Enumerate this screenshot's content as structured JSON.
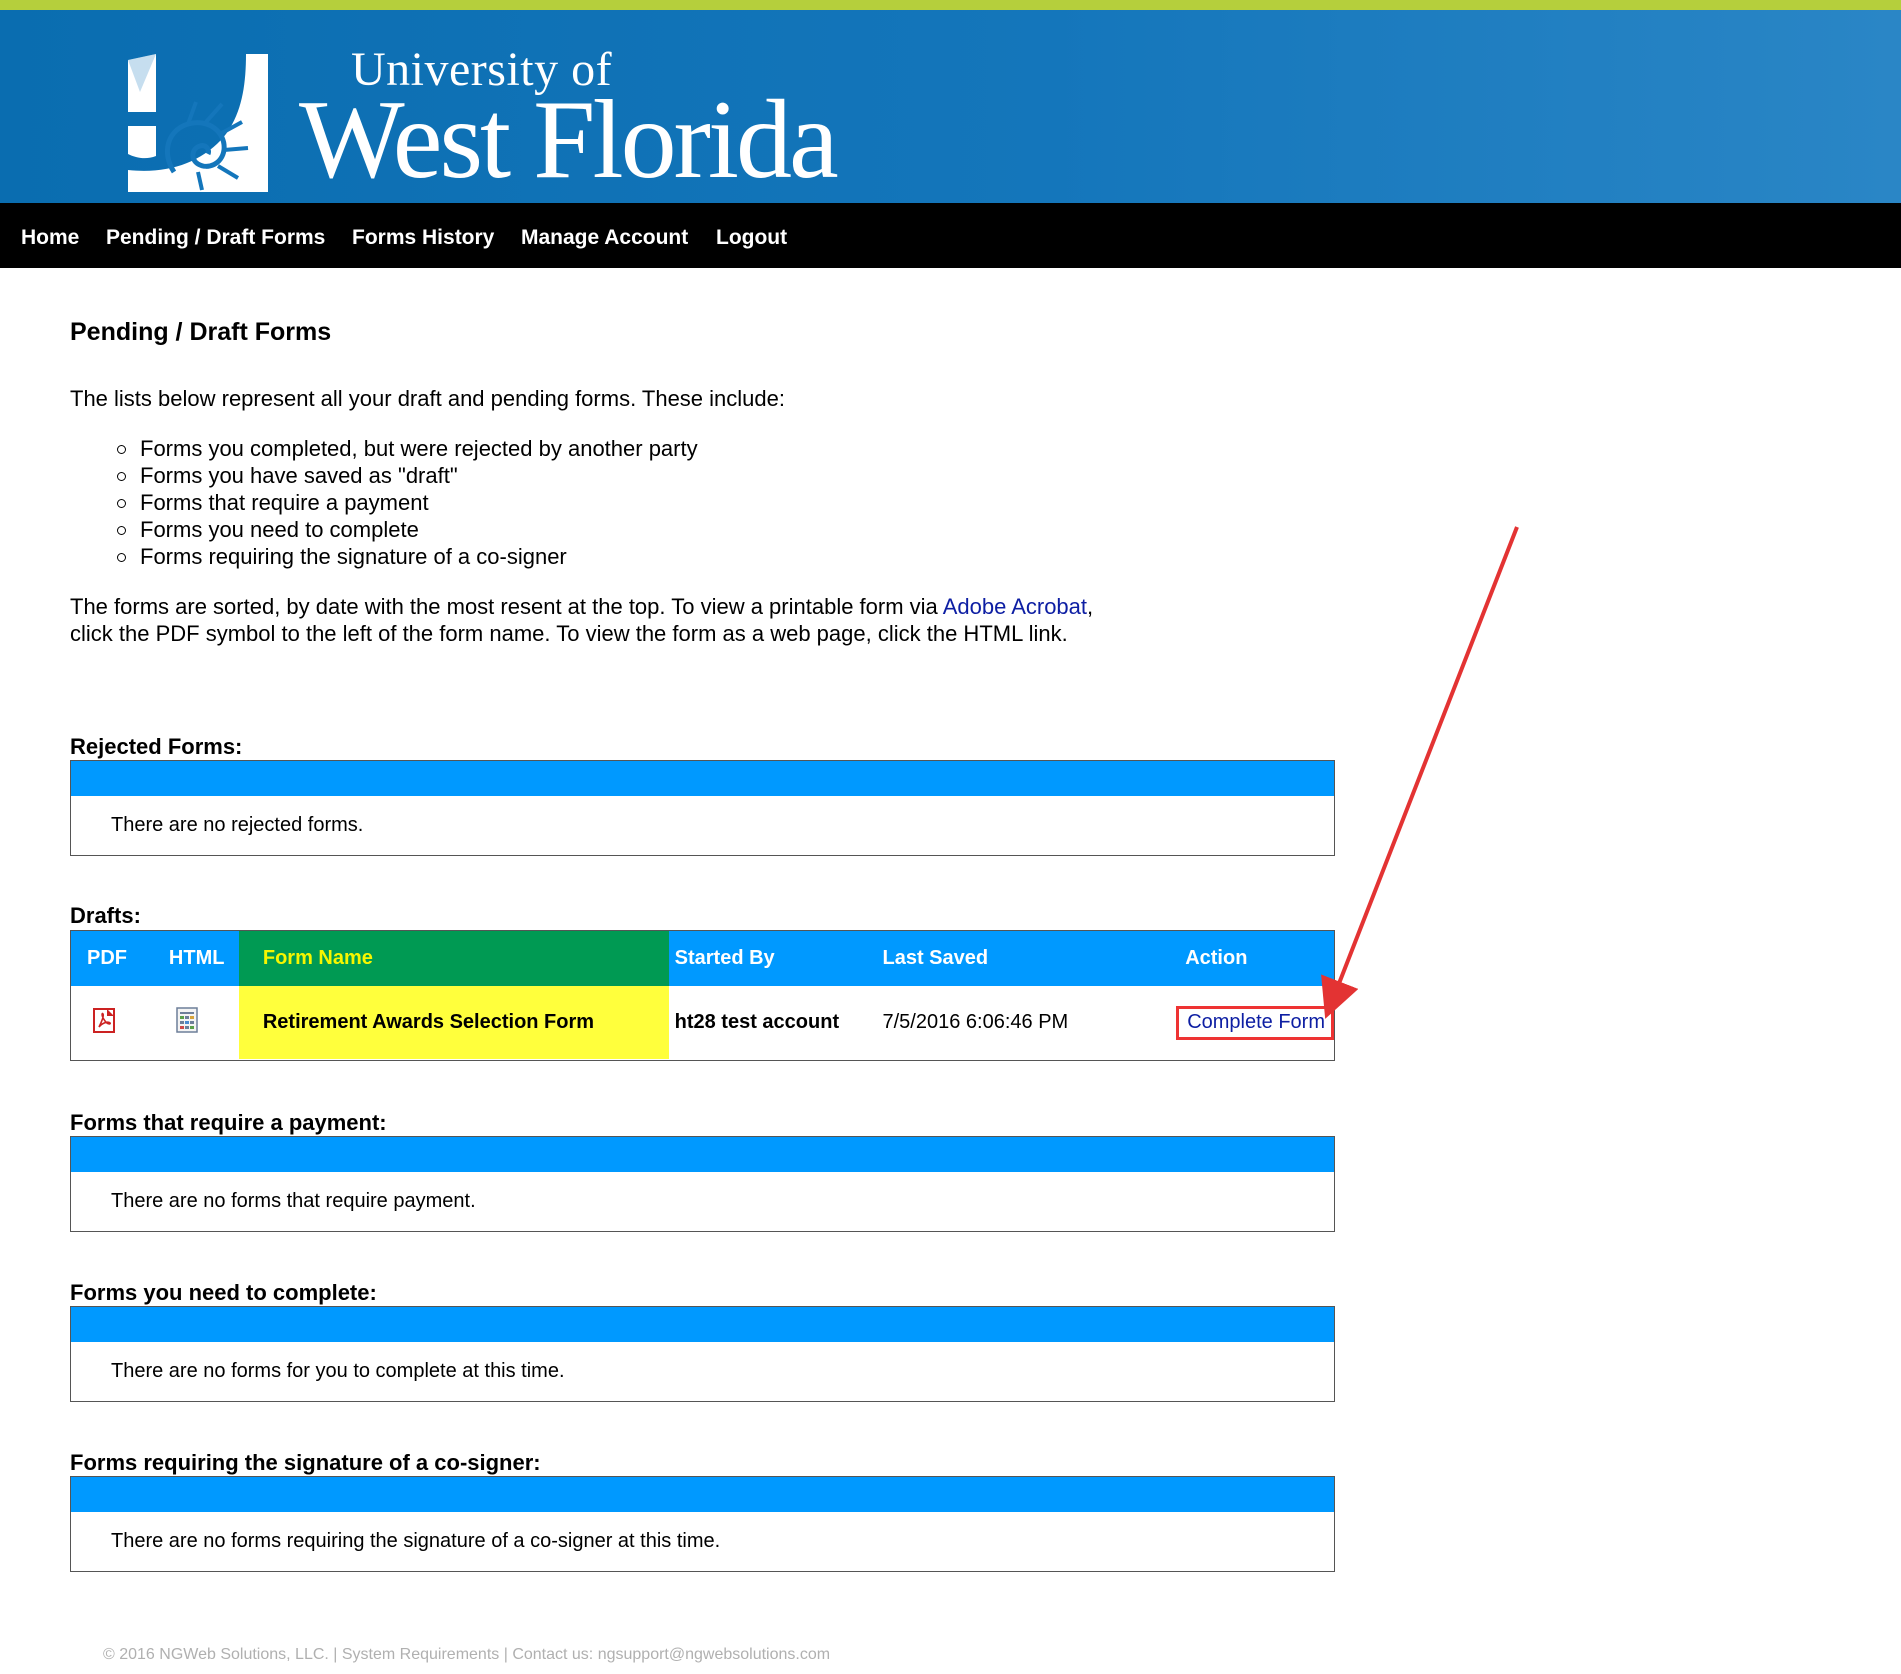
{
  "header": {
    "logo_line1": "University of",
    "logo_line2": "West Florida"
  },
  "nav": [
    "Home",
    "Pending / Draft Forms",
    "Forms History",
    "Manage Account",
    "Logout"
  ],
  "page": {
    "title": "Pending / Draft Forms",
    "intro": "The lists below represent all your draft and pending forms. These include:",
    "bullets": [
      "Forms you completed, but were rejected by another party",
      "Forms you have saved as \"draft\"",
      "Forms that require a payment",
      "Forms you need to complete",
      "Forms requiring the signature of a co-signer"
    ],
    "sorted_before": "The forms are sorted, by date with the most resent at the top. To view a printable form via ",
    "sorted_link": "Adobe Acrobat",
    "sorted_after": ", click the PDF symbol to the left of the form name. To view the form as a web page, click the HTML link."
  },
  "sections": {
    "rejected": {
      "title": "Rejected Forms:",
      "empty": "There are no rejected forms."
    },
    "drafts": {
      "title": "Drafts:",
      "columns": [
        "PDF",
        "HTML",
        "Form Name",
        "Started By",
        "Last Saved",
        "Action"
      ],
      "rows": [
        {
          "pdf_icon": "pdf-icon",
          "html_icon": "html-doc-icon",
          "form_name": "Retirement Awards Selection Form",
          "started_by": "ht28 test account",
          "last_saved": "7/5/2016 6:06:46 PM",
          "action": "Complete Form"
        }
      ]
    },
    "payment": {
      "title": "Forms that require a payment:",
      "empty": "There are no forms that require payment."
    },
    "complete": {
      "title": "Forms you need to complete:",
      "empty": "There are no forms for you to complete at this time."
    },
    "cosigner": {
      "title": "Forms requiring the signature of a co-signer:",
      "empty": "There are no forms requiring the signature of a co-signer at this time."
    }
  },
  "footer": "© 2016 NGWeb Solutions, LLC. | System Requirements | Contact us: ngsupport@ngwebsolutions.com",
  "colors": {
    "accent_bar": "#b5cf3c",
    "header_blue": "#1476bb",
    "table_header": "#0099ff",
    "form_name_header": "#009a53",
    "form_name_highlight": "#ffff3c",
    "annotation_red": "#e33333"
  }
}
